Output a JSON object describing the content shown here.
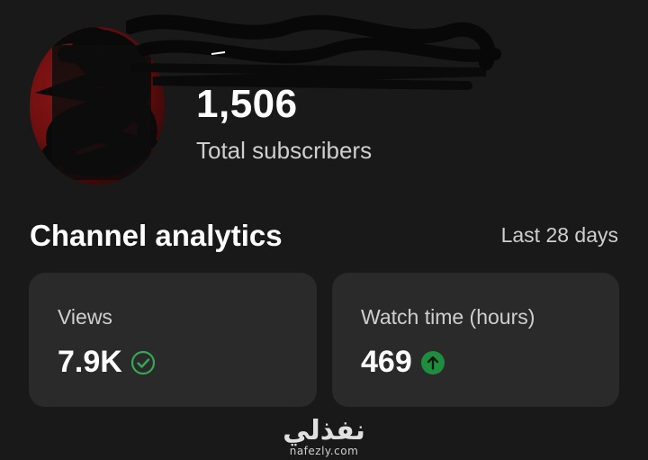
{
  "header": {
    "subscriber_count": "1,506",
    "subscriber_label": "Total subscribers"
  },
  "analytics": {
    "title": "Channel analytics",
    "period": "Last 28 days",
    "cards": [
      {
        "label": "Views",
        "value": "7.9K",
        "status_icon": "check-circle-icon",
        "status_color": "#34a853"
      },
      {
        "label": "Watch time (hours)",
        "value": "469",
        "status_icon": "arrow-up-circle-icon",
        "status_color": "#1e8e3e"
      }
    ]
  },
  "watermark": {
    "arabic": "نفذلي",
    "url": "nafezly.com"
  },
  "colors": {
    "background": "#191919",
    "card": "#2a2a2a",
    "avatar_red": "#8e1717"
  }
}
